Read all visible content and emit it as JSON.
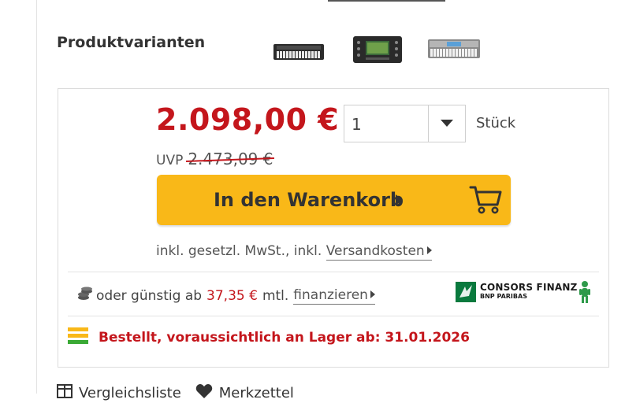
{
  "variants": {
    "label": "Produktvarianten",
    "thumbnails": [
      "keyboard-thumbnail-black",
      "keyboard-thumbnail-panel",
      "keyboard-thumbnail-silver"
    ]
  },
  "pricing": {
    "price": "2.098,00 €",
    "uvp_label": "UVP",
    "uvp_value": "2.473,09 €",
    "quantity": "1",
    "unit": "Stück"
  },
  "cart": {
    "button_label": "In den Warenkorb",
    "icon": "shopping-cart-icon"
  },
  "tax": {
    "prefix": "inkl. gesetzl. MwSt., inkl.",
    "shipping_link": "Versandkosten"
  },
  "finance": {
    "prefix": "oder günstig ab",
    "rate": "37,35 €",
    "suffix": "mtl.",
    "link": "finanzieren",
    "provider_name": "CONSORS FINANZ",
    "provider_sub": "BNP PARIBAS"
  },
  "stock": {
    "text": "Bestellt, voraussichtlich an Lager ab: 31.01.2026",
    "colors": [
      "#f9b818",
      "#f9b818",
      "#3aa935"
    ]
  },
  "bottom": {
    "compare_label": "Vergleichsliste",
    "wishlist_label": "Merkzettel"
  },
  "colors": {
    "accent_red": "#c4161c",
    "button_yellow": "#f9b818",
    "consors_green": "#0a7a3e"
  }
}
